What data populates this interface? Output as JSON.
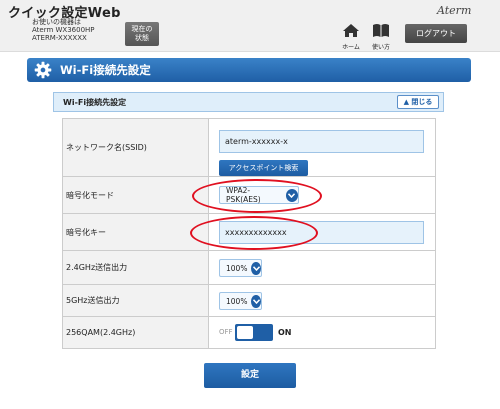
{
  "header": {
    "app_title": "クイック設定Web",
    "device_info": [
      "お使いの機器は",
      "Aterm WX3600HP",
      "ATERM-XXXXXX"
    ],
    "status_button": [
      "現在の",
      "状態"
    ],
    "brand": "Aterm",
    "nav": {
      "home_label": "ホーム",
      "help_label": "使い方"
    },
    "logout_label": "ログアウト"
  },
  "section": {
    "title": "Wi-Fi接続先設定",
    "icon": "gear-icon"
  },
  "subsection": {
    "title": "Wi-Fi接続先設定",
    "close_label": "閉じる",
    "close_icon": "caret-up-icon"
  },
  "form": {
    "ssid": {
      "label": "ネットワーク名(SSID)",
      "value": "aterm-xxxxxx-x",
      "ap_search_label": "アクセスポイント検索"
    },
    "encryption_mode": {
      "label": "暗号化モード",
      "value": "WPA2-PSK(AES)"
    },
    "encryption_key": {
      "label": "暗号化キー",
      "value": "xxxxxxxxxxxxx"
    },
    "tx_power_24": {
      "label": "2.4GHz送信出力",
      "value": "100%"
    },
    "tx_power_5": {
      "label": "5GHz送信出力",
      "value": "100%"
    },
    "qam256": {
      "label": "256QAM(2.4GHz)",
      "off_label": "OFF",
      "on_label": "ON",
      "state": "on"
    }
  },
  "submit_label": "設定",
  "colors": {
    "accent": "#1f5fa6",
    "annotation": "#e01020",
    "field_bg": "#e6f2fb"
  }
}
